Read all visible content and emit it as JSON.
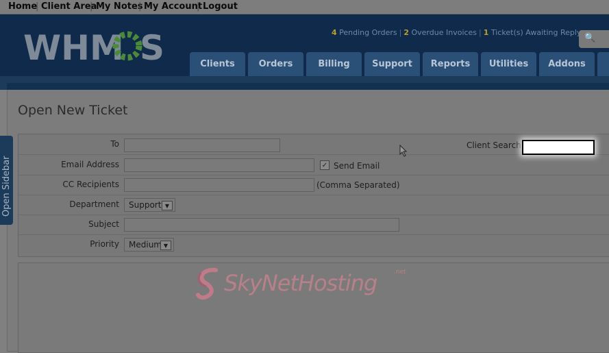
{
  "topnav": {
    "items": [
      "Home",
      "Client Area",
      "My Notes",
      "My Account",
      "Logout"
    ],
    "separator": "|"
  },
  "header": {
    "logo_text": "WHMCS",
    "alerts": {
      "pending_orders_count": "4",
      "pending_orders_label": "Pending Orders",
      "overdue_invoices_count": "2",
      "overdue_invoices_label": "Overdue Invoices",
      "tickets_count": "1",
      "tickets_label": "Ticket(s) Awaiting Reply",
      "separator": "|"
    },
    "search_icon": "search-icon"
  },
  "tabs": [
    "Clients",
    "Orders",
    "Billing",
    "Support",
    "Reports",
    "Utilities",
    "Addons"
  ],
  "sidebar": {
    "label": "Open Sidebar",
    "arrows": "» «"
  },
  "page": {
    "title": "Open New Ticket",
    "form": {
      "to_label": "To",
      "to_value": "",
      "client_search_label": "Client Search:",
      "client_search_value": "",
      "email_label": "Email Address",
      "email_value": "",
      "send_email_label": "Send Email",
      "send_email_checked": true,
      "cc_label": "CC Recipients",
      "cc_value": "",
      "cc_hint": "(Comma Separated)",
      "department_label": "Department",
      "department_value": "Support",
      "subject_label": "Subject",
      "subject_value": "",
      "priority_label": "Priority",
      "priority_value": "Medium"
    }
  },
  "watermark": {
    "text": "SkyNetHosting",
    "suffix": ".net"
  },
  "colors": {
    "header_bg": "#0f2a4a",
    "tab_bg": "#2b5077",
    "alert_number": "#b8a030",
    "logo_gear": "#4a8a3a"
  }
}
